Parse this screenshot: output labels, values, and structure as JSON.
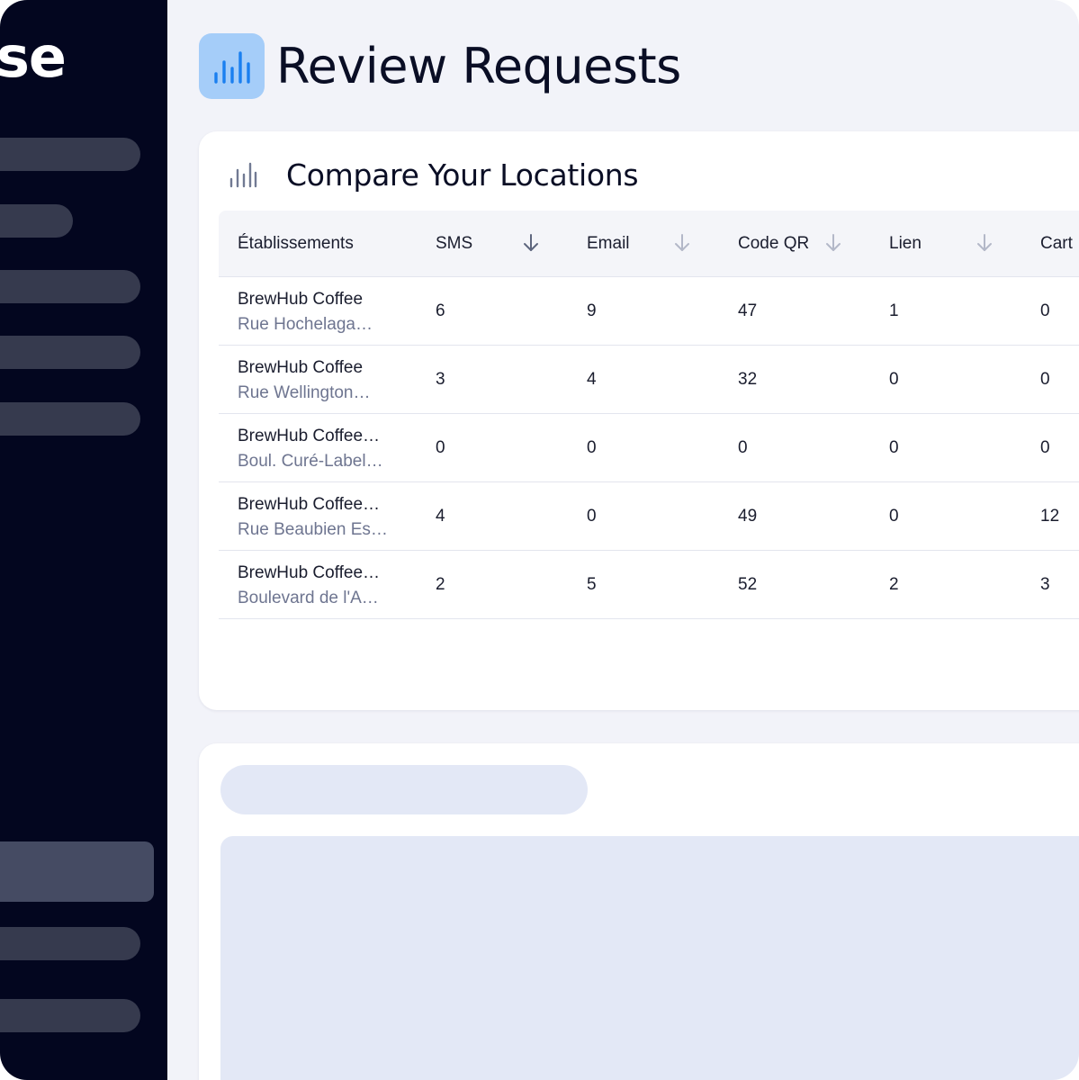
{
  "app": {
    "logo_fragment": "se",
    "page_title": "Review Requests"
  },
  "colors": {
    "sidebar_bg": "#03061f",
    "accent": "#1a7ff0",
    "accent_bg": "#a5cdf9",
    "skeleton": "#e3e8f6"
  },
  "icons": {
    "header": "bar-chart-icon",
    "card": "bar-chart-icon",
    "sort": "arrow-down-icon"
  },
  "compare": {
    "title": "Compare Your Locations",
    "columns": [
      "Établissements",
      "SMS",
      "Email",
      "Code QR",
      "Lien",
      "Cart"
    ],
    "rows": [
      {
        "name": "BrewHub Coffee",
        "address": "Rue Hochelaga…",
        "values": [
          "6",
          "9",
          "47",
          "1",
          "0"
        ]
      },
      {
        "name": "BrewHub Coffee",
        "address": "Rue Wellington…",
        "values": [
          "3",
          "4",
          "32",
          "0",
          "0"
        ]
      },
      {
        "name": "BrewHub Coffee…",
        "address": "Boul. Curé-Label…",
        "values": [
          "0",
          "0",
          "0",
          "0",
          "0"
        ]
      },
      {
        "name": "BrewHub Coffee…",
        "address": "Rue Beaubien Es…",
        "values": [
          "4",
          "0",
          "49",
          "0",
          "12"
        ]
      },
      {
        "name": "BrewHub Coffee…",
        "address": "Boulevard de l'A…",
        "values": [
          "2",
          "5",
          "52",
          "2",
          "3"
        ]
      }
    ]
  }
}
